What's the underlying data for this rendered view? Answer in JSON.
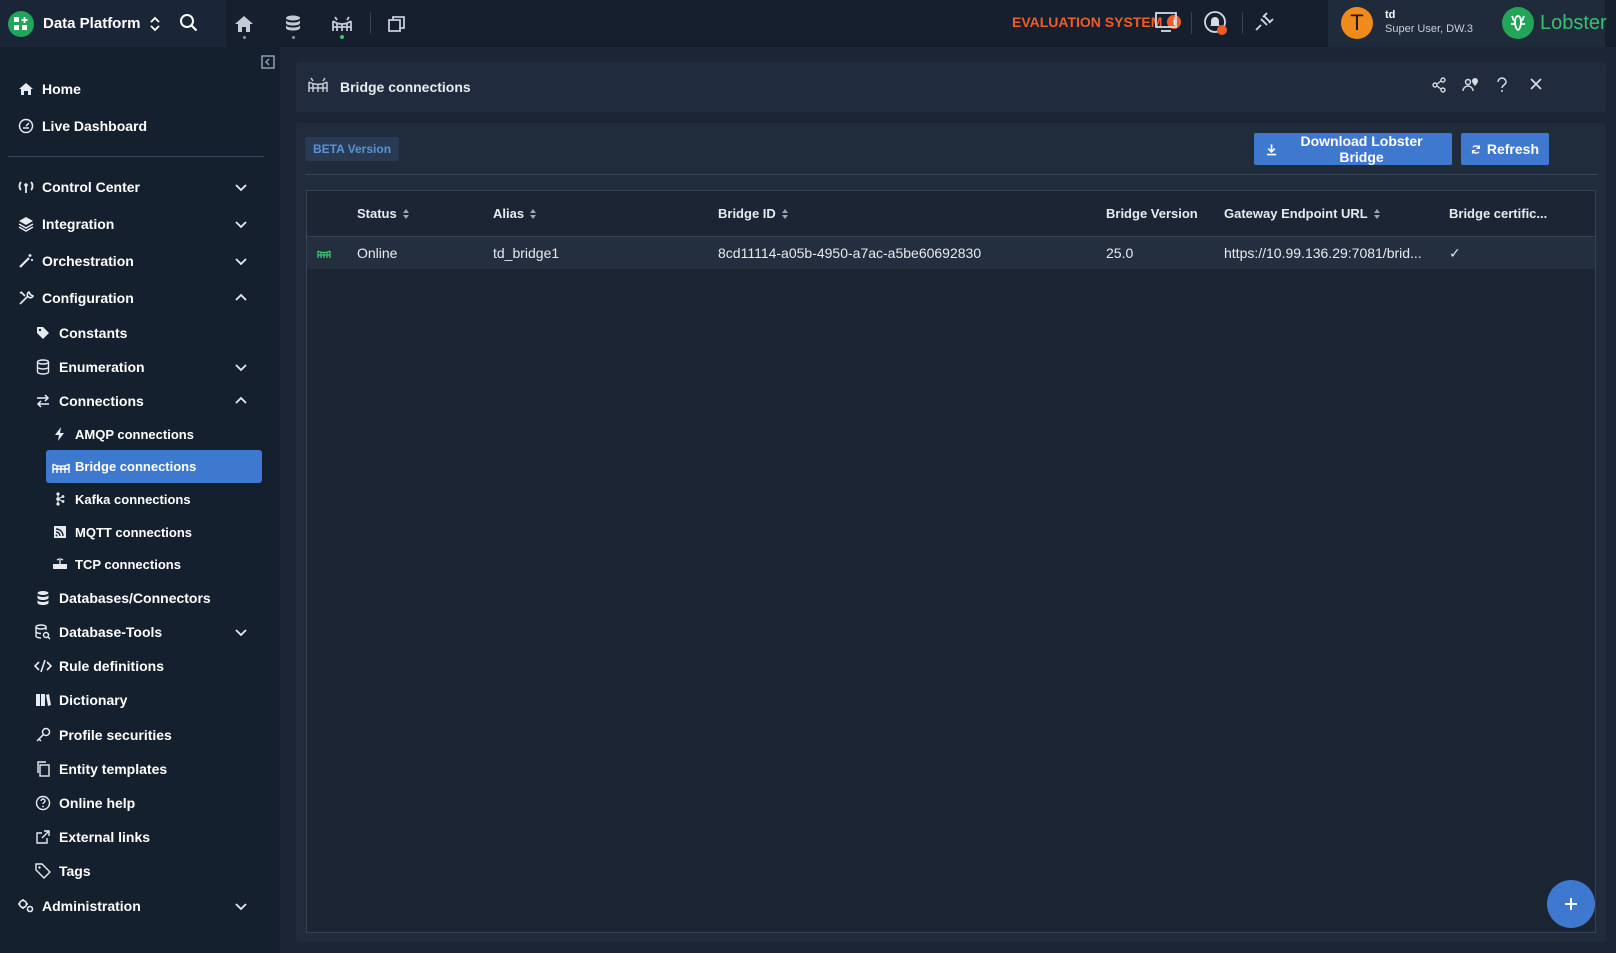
{
  "app": {
    "title": "Data Platform"
  },
  "topbar": {
    "evaluation": "EVALUATION SYSTEM",
    "evaluation_info": "i",
    "user": {
      "initial": "T",
      "name": "td",
      "role": "Super User, DW.3"
    },
    "brand": "Lobster"
  },
  "sidebar": {
    "home": "Home",
    "live_dashboard": "Live Dashboard",
    "control_center": "Control Center",
    "integration": "Integration",
    "orchestration": "Orchestration",
    "configuration": "Configuration",
    "constants": "Constants",
    "enumeration": "Enumeration",
    "connections": "Connections",
    "amqp": "AMQP connections",
    "bridge": "Bridge connections",
    "kafka": "Kafka connections",
    "mqtt": "MQTT connections",
    "tcp": "TCP connections",
    "databases": "Databases/Connectors",
    "database_tools": "Database-Tools",
    "rule_definitions": "Rule definitions",
    "dictionary": "Dictionary",
    "profile_securities": "Profile securities",
    "entity_templates": "Entity templates",
    "online_help": "Online help",
    "external_links": "External links",
    "tags": "Tags",
    "administration": "Administration"
  },
  "panel": {
    "title": "Bridge connections",
    "beta": "BETA Version",
    "download_label": "Download Lobster Bridge",
    "refresh_label": "Refresh"
  },
  "table": {
    "headers": {
      "status": "Status",
      "alias": "Alias",
      "bridge_id": "Bridge ID",
      "version": "Bridge Version",
      "gateway": "Gateway Endpoint URL",
      "cert": "Bridge certific..."
    },
    "rows": [
      {
        "status": "Online",
        "alias": "td_bridge1",
        "bridge_id": "8cd11114-a05b-4950-a7ac-a5be60692830",
        "version": "25.0",
        "gateway": "https://10.99.136.29:7081/brid...",
        "cert": "✓"
      }
    ]
  },
  "colors": {
    "accent": "#3f79cf",
    "eval": "#f05c28",
    "online": "#3cc46a",
    "brand_green": "#22a559"
  }
}
